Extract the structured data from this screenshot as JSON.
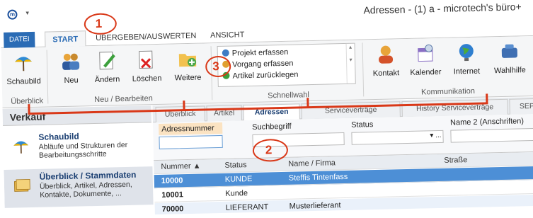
{
  "window_title": "Adressen - (1) a - microtech's büro+",
  "quick_access_arrow": "▾",
  "tabs": {
    "datei": "DATEI",
    "start": "START",
    "uebergeben": "ÜBERGEBEN/AUSWERTEN",
    "ansicht": "ANSICHT"
  },
  "ribbon": {
    "groups": {
      "ueberblick": "Überblick",
      "neu_bearbeiten": "Neu / Bearbeiten",
      "schnellwahl": "Schnellwahl",
      "kommunikation": "Kommunikation"
    },
    "buttons": {
      "schaubild": "Schaubild",
      "neu": "Neu",
      "aendern": "Ändern",
      "loeschen": "Löschen",
      "weitere": "Weitere",
      "kontakt": "Kontakt",
      "kalender": "Kalender",
      "internet": "Internet",
      "wahlhilfe": "Wahlhilfe"
    },
    "schnellwahl_items": [
      "Projekt erfassen",
      "Vorgang erfassen",
      "Artikel zurücklegen"
    ]
  },
  "sidebar": {
    "title": "Verkauf",
    "items": [
      {
        "title": "Schaubild",
        "desc": "Abläufe und Strukturen der Bearbeitungsschritte"
      },
      {
        "title": "Überblick / Stammdaten",
        "desc": "Überblick, Artikel, Adressen, Kontakte, Dokumente, ..."
      }
    ]
  },
  "content_tabs": [
    "Überblick",
    "Artikel",
    "Adressen",
    "Serviceverträge",
    "History Serviceverträge",
    "SEPA"
  ],
  "filter": {
    "labels": [
      "Adressnummer",
      "Suchbegriff",
      "Status",
      "Name 2 (Anschriften)"
    ],
    "adressnummer_value": "",
    "status_buttons": "▾ ..."
  },
  "grid": {
    "headers": [
      "Nummer ▲",
      "Status",
      "Name / Firma",
      "Straße"
    ],
    "rows": [
      [
        "10000",
        "KUNDE",
        "Steffis Tintenfass",
        ""
      ],
      [
        "10001",
        "Kunde",
        "",
        ""
      ],
      [
        "70000",
        "LIEFERANT",
        "Musterlieferant",
        ""
      ]
    ]
  },
  "annotations": [
    "1",
    "2",
    "3"
  ],
  "colors": {
    "accent": "#2b6cb5",
    "annotation": "#d93818",
    "selected_row": "#4d8fd6"
  }
}
